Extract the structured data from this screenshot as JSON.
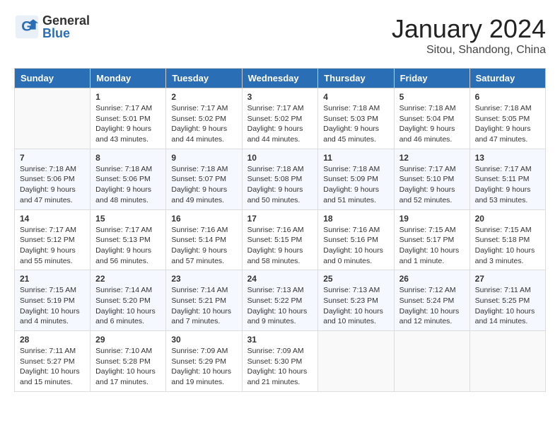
{
  "header": {
    "logo_general": "General",
    "logo_blue": "Blue",
    "month_year": "January 2024",
    "location": "Sitou, Shandong, China"
  },
  "days_of_week": [
    "Sunday",
    "Monday",
    "Tuesday",
    "Wednesday",
    "Thursday",
    "Friday",
    "Saturday"
  ],
  "weeks": [
    [
      null,
      {
        "day": 1,
        "sunrise": "7:17 AM",
        "sunset": "5:01 PM",
        "daylight": "9 hours and 43 minutes."
      },
      {
        "day": 2,
        "sunrise": "7:17 AM",
        "sunset": "5:02 PM",
        "daylight": "9 hours and 44 minutes."
      },
      {
        "day": 3,
        "sunrise": "7:17 AM",
        "sunset": "5:02 PM",
        "daylight": "9 hours and 44 minutes."
      },
      {
        "day": 4,
        "sunrise": "7:18 AM",
        "sunset": "5:03 PM",
        "daylight": "9 hours and 45 minutes."
      },
      {
        "day": 5,
        "sunrise": "7:18 AM",
        "sunset": "5:04 PM",
        "daylight": "9 hours and 46 minutes."
      },
      {
        "day": 6,
        "sunrise": "7:18 AM",
        "sunset": "5:05 PM",
        "daylight": "9 hours and 47 minutes."
      }
    ],
    [
      {
        "day": 7,
        "sunrise": "7:18 AM",
        "sunset": "5:06 PM",
        "daylight": "9 hours and 47 minutes."
      },
      {
        "day": 8,
        "sunrise": "7:18 AM",
        "sunset": "5:06 PM",
        "daylight": "9 hours and 48 minutes."
      },
      {
        "day": 9,
        "sunrise": "7:18 AM",
        "sunset": "5:07 PM",
        "daylight": "9 hours and 49 minutes."
      },
      {
        "day": 10,
        "sunrise": "7:18 AM",
        "sunset": "5:08 PM",
        "daylight": "9 hours and 50 minutes."
      },
      {
        "day": 11,
        "sunrise": "7:18 AM",
        "sunset": "5:09 PM",
        "daylight": "9 hours and 51 minutes."
      },
      {
        "day": 12,
        "sunrise": "7:17 AM",
        "sunset": "5:10 PM",
        "daylight": "9 hours and 52 minutes."
      },
      {
        "day": 13,
        "sunrise": "7:17 AM",
        "sunset": "5:11 PM",
        "daylight": "9 hours and 53 minutes."
      }
    ],
    [
      {
        "day": 14,
        "sunrise": "7:17 AM",
        "sunset": "5:12 PM",
        "daylight": "9 hours and 55 minutes."
      },
      {
        "day": 15,
        "sunrise": "7:17 AM",
        "sunset": "5:13 PM",
        "daylight": "9 hours and 56 minutes."
      },
      {
        "day": 16,
        "sunrise": "7:16 AM",
        "sunset": "5:14 PM",
        "daylight": "9 hours and 57 minutes."
      },
      {
        "day": 17,
        "sunrise": "7:16 AM",
        "sunset": "5:15 PM",
        "daylight": "9 hours and 58 minutes."
      },
      {
        "day": 18,
        "sunrise": "7:16 AM",
        "sunset": "5:16 PM",
        "daylight": "10 hours and 0 minutes."
      },
      {
        "day": 19,
        "sunrise": "7:15 AM",
        "sunset": "5:17 PM",
        "daylight": "10 hours and 1 minute."
      },
      {
        "day": 20,
        "sunrise": "7:15 AM",
        "sunset": "5:18 PM",
        "daylight": "10 hours and 3 minutes."
      }
    ],
    [
      {
        "day": 21,
        "sunrise": "7:15 AM",
        "sunset": "5:19 PM",
        "daylight": "10 hours and 4 minutes."
      },
      {
        "day": 22,
        "sunrise": "7:14 AM",
        "sunset": "5:20 PM",
        "daylight": "10 hours and 6 minutes."
      },
      {
        "day": 23,
        "sunrise": "7:14 AM",
        "sunset": "5:21 PM",
        "daylight": "10 hours and 7 minutes."
      },
      {
        "day": 24,
        "sunrise": "7:13 AM",
        "sunset": "5:22 PM",
        "daylight": "10 hours and 9 minutes."
      },
      {
        "day": 25,
        "sunrise": "7:13 AM",
        "sunset": "5:23 PM",
        "daylight": "10 hours and 10 minutes."
      },
      {
        "day": 26,
        "sunrise": "7:12 AM",
        "sunset": "5:24 PM",
        "daylight": "10 hours and 12 minutes."
      },
      {
        "day": 27,
        "sunrise": "7:11 AM",
        "sunset": "5:25 PM",
        "daylight": "10 hours and 14 minutes."
      }
    ],
    [
      {
        "day": 28,
        "sunrise": "7:11 AM",
        "sunset": "5:27 PM",
        "daylight": "10 hours and 15 minutes."
      },
      {
        "day": 29,
        "sunrise": "7:10 AM",
        "sunset": "5:28 PM",
        "daylight": "10 hours and 17 minutes."
      },
      {
        "day": 30,
        "sunrise": "7:09 AM",
        "sunset": "5:29 PM",
        "daylight": "10 hours and 19 minutes."
      },
      {
        "day": 31,
        "sunrise": "7:09 AM",
        "sunset": "5:30 PM",
        "daylight": "10 hours and 21 minutes."
      },
      null,
      null,
      null
    ]
  ]
}
